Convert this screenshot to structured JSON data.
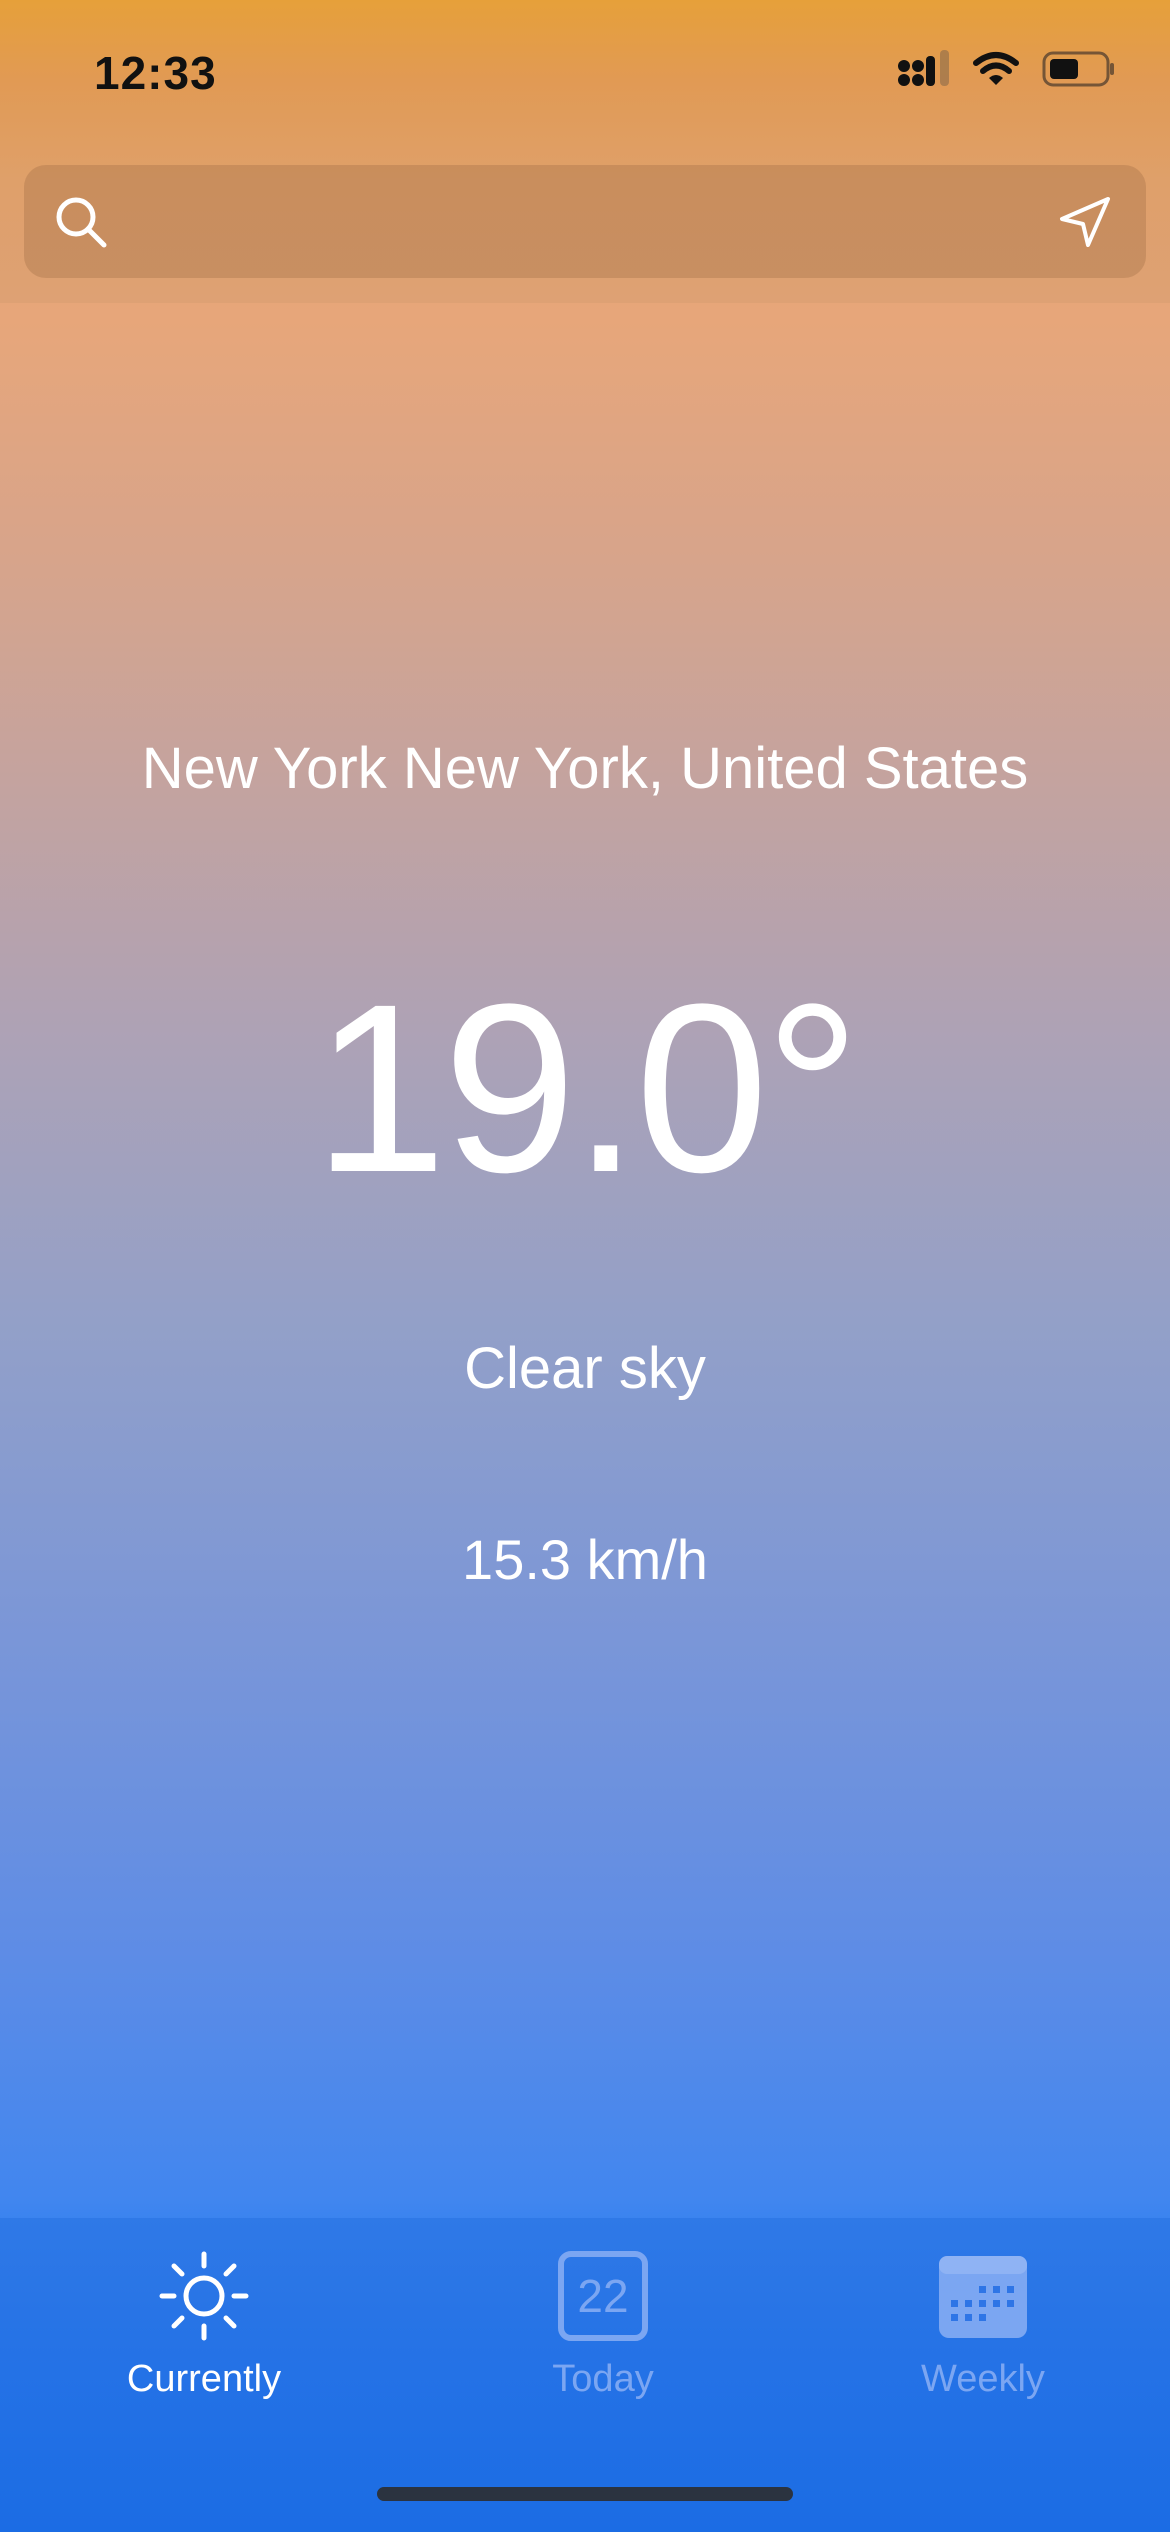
{
  "status_bar": {
    "time": "12:33",
    "icons": [
      "signal-icon",
      "wifi-icon",
      "battery-icon"
    ]
  },
  "search": {
    "placeholder": "",
    "value": "",
    "left_icon": "search-icon",
    "right_icon": "location-arrow-icon"
  },
  "weather": {
    "location": "New York New York, United States",
    "temperature": "19.0°",
    "condition": "Clear sky",
    "wind_speed": "15.3 km/h"
  },
  "tabs": [
    {
      "label": "Currently",
      "icon": "sun-icon",
      "active": true
    },
    {
      "label": "Today",
      "icon": "calendar-day-icon",
      "icon_text": "22",
      "active": false
    },
    {
      "label": "Weekly",
      "icon": "calendar-grid-icon",
      "active": false
    }
  ],
  "colors": {
    "tab_active": "#ffffff",
    "tab_inactive": "#7ba6f2",
    "gradient_top": "#e89e6a",
    "gradient_bottom": "#3a83ef"
  }
}
